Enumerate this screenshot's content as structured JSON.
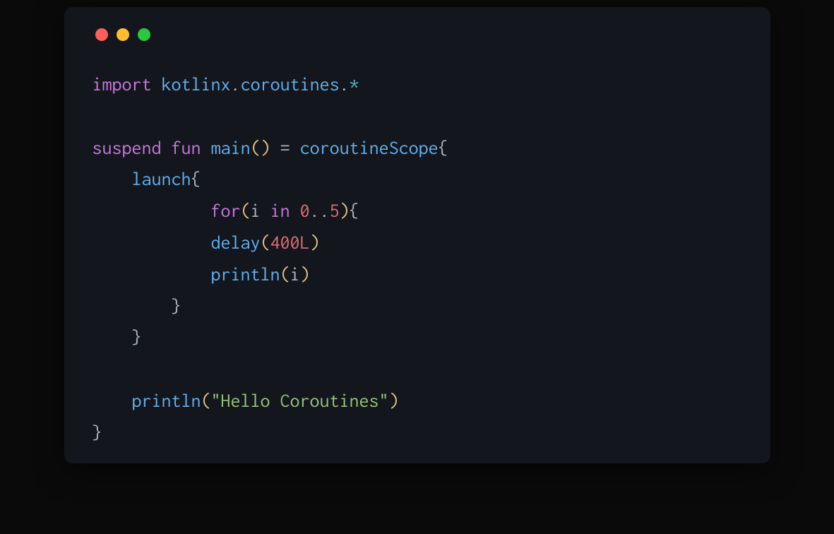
{
  "window": {
    "dots": {
      "red": "close",
      "yellow": "minimize",
      "green": "maximize"
    }
  },
  "code": {
    "line1": {
      "import": "import",
      "pkg1": "kotlinx",
      "dot1": ".",
      "pkg2": "coroutines",
      "dot2": ".",
      "star": "*"
    },
    "line3": {
      "suspend": "suspend",
      "fun": "fun",
      "main": "main",
      "parens": "()",
      "eq": " = ",
      "cs": "coroutineScope",
      "brace": "{"
    },
    "line4": {
      "launch": "launch",
      "brace": "{"
    },
    "line5": {
      "for": "for",
      "lparen": "(",
      "i": "i",
      "in": " in ",
      "zero": "0",
      "range": "..",
      "five": "5",
      "rparen": ")",
      "brace": "{"
    },
    "line6": {
      "delay": "delay",
      "lparen": "(",
      "val": "400L",
      "rparen": ")"
    },
    "line7": {
      "println": "println",
      "lparen": "(",
      "i": "i",
      "rparen": ")"
    },
    "line8": {
      "brace": "}"
    },
    "line9": {
      "brace": "}"
    },
    "line11": {
      "println": "println",
      "lparen": "(",
      "str": "\"Hello Coroutines\"",
      "rparen": ")"
    },
    "line12": {
      "brace": "}"
    }
  }
}
